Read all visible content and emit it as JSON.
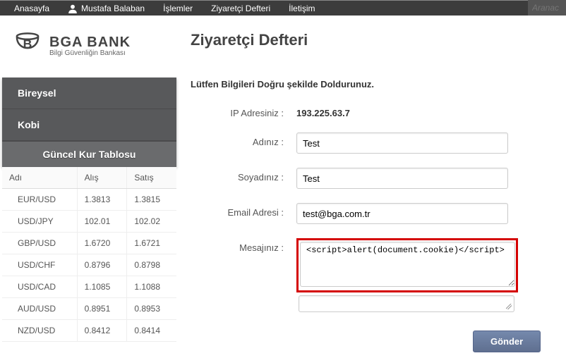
{
  "topnav": {
    "items": [
      "Anasayfa",
      "Mustafa Balaban",
      "İşlemler",
      "Ziyaretçi Defteri",
      "İletişim"
    ],
    "search_placeholder": "Aranac"
  },
  "logo": {
    "brand": "BGA BANK",
    "tagline": "Bilgi Güvenliğin Bankası"
  },
  "page_title": "Ziyaretçi Defteri",
  "sidebar": {
    "menu": [
      "Bireysel",
      "Kobi"
    ],
    "kur_header": "Güncel Kur Tablosu",
    "kur_cols": [
      "Adı",
      "Alış",
      "Satış"
    ],
    "kur_rows": [
      {
        "name": "EUR/USD",
        "buy": "1.3813",
        "sell": "1.3815"
      },
      {
        "name": "USD/JPY",
        "buy": "102.01",
        "sell": "102.02"
      },
      {
        "name": "GBP/USD",
        "buy": "1.6720",
        "sell": "1.6721"
      },
      {
        "name": "USD/CHF",
        "buy": "0.8796",
        "sell": "0.8798"
      },
      {
        "name": "USD/CAD",
        "buy": "1.1085",
        "sell": "1.1088"
      },
      {
        "name": "AUD/USD",
        "buy": "0.8951",
        "sell": "0.8953"
      },
      {
        "name": "NZD/USD",
        "buy": "0.8412",
        "sell": "0.8414"
      }
    ]
  },
  "form": {
    "instruction": "Lütfen Bilgileri Doğru şekilde Doldurunuz.",
    "rows": {
      "ip_label": "IP Adresiniz :",
      "ip_value": "193.225.63.7",
      "name_label": "Adınız :",
      "name_value": "Test",
      "surname_label": "Soyadınız :",
      "surname_value": "Test",
      "email_label": "Email Adresi :",
      "email_value": "test@bga.com.tr",
      "message_label": "Mesajınız :",
      "message_value": "<script>alert(document.cookie)</script>"
    },
    "submit_label": "Gönder"
  }
}
